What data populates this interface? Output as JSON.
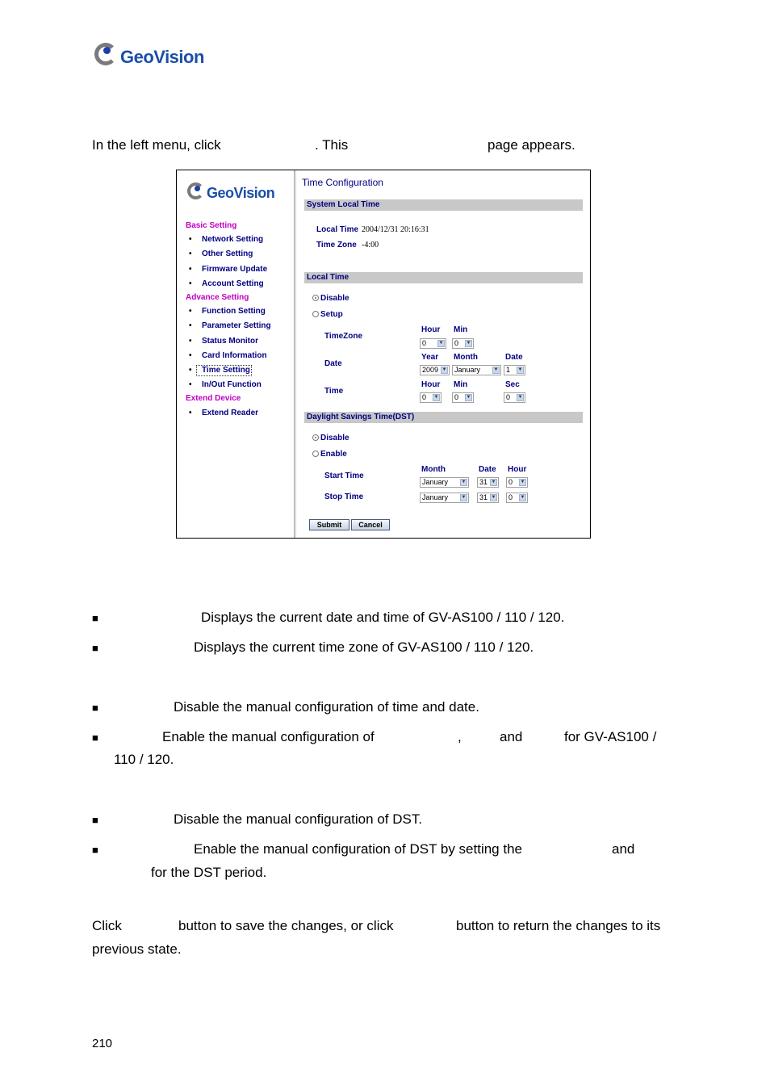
{
  "header_logo": {
    "text": "GeoVision"
  },
  "intro": {
    "part1": "In the left menu, click",
    "part2": ". This",
    "part3": "page appears."
  },
  "screenshot": {
    "logo_text": "GeoVision",
    "menu": [
      {
        "type": "header",
        "label": "Basic Setting"
      },
      {
        "type": "item",
        "label": "Network Setting"
      },
      {
        "type": "item",
        "label": "Other Setting"
      },
      {
        "type": "item",
        "label": "Firmware Update"
      },
      {
        "type": "item",
        "label": "Account Setting"
      },
      {
        "type": "header",
        "label": "Advance Setting"
      },
      {
        "type": "item",
        "label": "Function Setting"
      },
      {
        "type": "item",
        "label": "Parameter Setting"
      },
      {
        "type": "item",
        "label": "Status Monitor"
      },
      {
        "type": "item",
        "label": "Card Information"
      },
      {
        "type": "item",
        "label": "Time Setting",
        "selected": true
      },
      {
        "type": "item",
        "label": "In/Out Function"
      },
      {
        "type": "header",
        "label": "Extend Device"
      },
      {
        "type": "item",
        "label": "Extend Reader"
      }
    ],
    "title": "Time Configuration",
    "system_local_time": {
      "section": "System Local Time",
      "local_time_label": "Local Time",
      "local_time_value": "2004/12/31 20:16:31",
      "time_zone_label": "Time Zone",
      "time_zone_value": "-4:00"
    },
    "local_time": {
      "section": "Local Time",
      "disable": "Disable",
      "setup": "Setup",
      "selected": "Disable",
      "timezone_label": "TimeZone",
      "date_label": "Date",
      "time_label": "Time",
      "hour": "Hour",
      "min": "Min",
      "year": "Year",
      "month": "Month",
      "date": "Date",
      "sec": "Sec",
      "tz_hour": "0",
      "tz_min": "0",
      "year_value": "2009",
      "month_value": "January",
      "date_value": "1",
      "time_hour": "0",
      "time_min": "0",
      "time_sec": "0"
    },
    "dst": {
      "section": "Daylight Savings Time(DST)",
      "disable": "Disable",
      "enable": "Enable",
      "selected": "Disable",
      "start_label": "Start Time",
      "stop_label": "Stop Time",
      "month": "Month",
      "date": "Date",
      "hour": "Hour",
      "start_month": "January",
      "start_date": "31",
      "start_hour": "0",
      "stop_month": "January",
      "stop_date": "31",
      "stop_hour": "0"
    },
    "submit": "Submit",
    "cancel": "Cancel"
  },
  "bullets": {
    "symbol": "■",
    "local_time_desc": "Displays the current date and time of GV-AS100 / 110 / 120.",
    "time_zone_desc": "Displays the current time zone of GV-AS100 / 110 / 120.",
    "lt_disable_desc": "Disable the manual configuration of time and date.",
    "lt_setup_desc_a": "Enable the manual configuration of",
    "lt_setup_desc_b": ",",
    "lt_setup_desc_c": "and",
    "lt_setup_desc_d": "for GV-AS100 /",
    "lt_setup_desc_e": "110 / 120.",
    "dst_disable_desc": "Disable the manual configuration of DST.",
    "dst_enable_desc_a": "Enable the manual configuration of DST by setting the",
    "dst_enable_desc_b": "and",
    "dst_enable_desc_c": "for the DST period."
  },
  "closing": {
    "a": "Click",
    "b": "button to save the changes, or click",
    "c": "button to return the changes to its",
    "d": "previous state."
  },
  "page_number": "210"
}
